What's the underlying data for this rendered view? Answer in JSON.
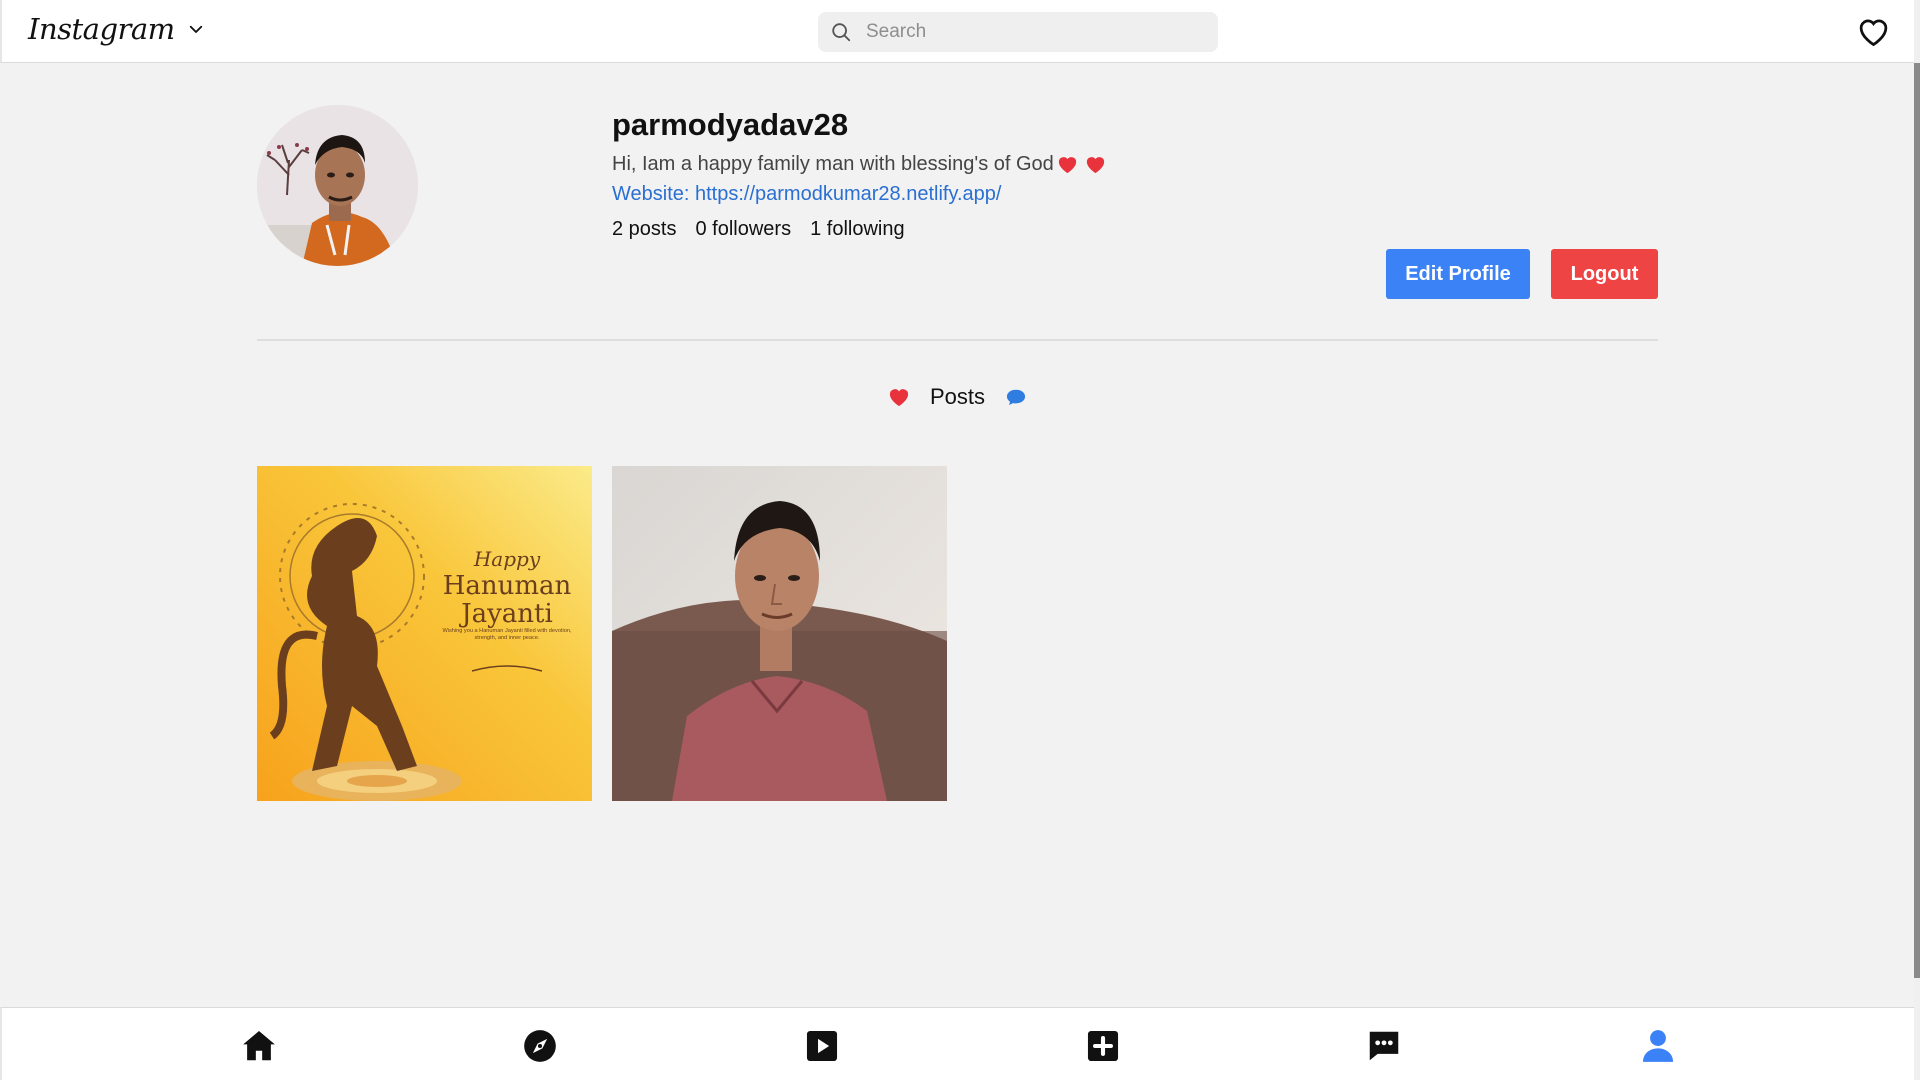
{
  "header": {
    "brand": "Instagram",
    "search_placeholder": "Search"
  },
  "profile": {
    "username": "parmodyadav28",
    "bio": "Hi, Iam a happy family man with blessing's of God",
    "website": "Website: https://parmodkumar28.netlify.app/",
    "stats": {
      "posts": "2 posts",
      "followers": "0 followers",
      "following": "1 following"
    },
    "buttons": {
      "edit": "Edit Profile",
      "logout": "Logout"
    }
  },
  "posts_section": {
    "label": "Posts",
    "items": [
      {
        "alt": "Hanuman Jayanti greeting",
        "title_script": "Happy",
        "title_line1": "Hanuman",
        "title_line2": "Jayanti",
        "caption": "Wishing you a Hanuman Jayanti filled with devotion, strength, and inner peace."
      },
      {
        "alt": "Portrait photo"
      }
    ]
  },
  "colors": {
    "accent_blue": "#3b82f6",
    "danger_red": "#ef4444",
    "link_blue": "#2a6fd1",
    "heart_red": "#e8323c"
  },
  "bottom_nav": [
    {
      "icon": "home-icon"
    },
    {
      "icon": "explore-icon"
    },
    {
      "icon": "reels-icon"
    },
    {
      "icon": "create-icon"
    },
    {
      "icon": "messages-icon"
    },
    {
      "icon": "profile-icon"
    }
  ]
}
